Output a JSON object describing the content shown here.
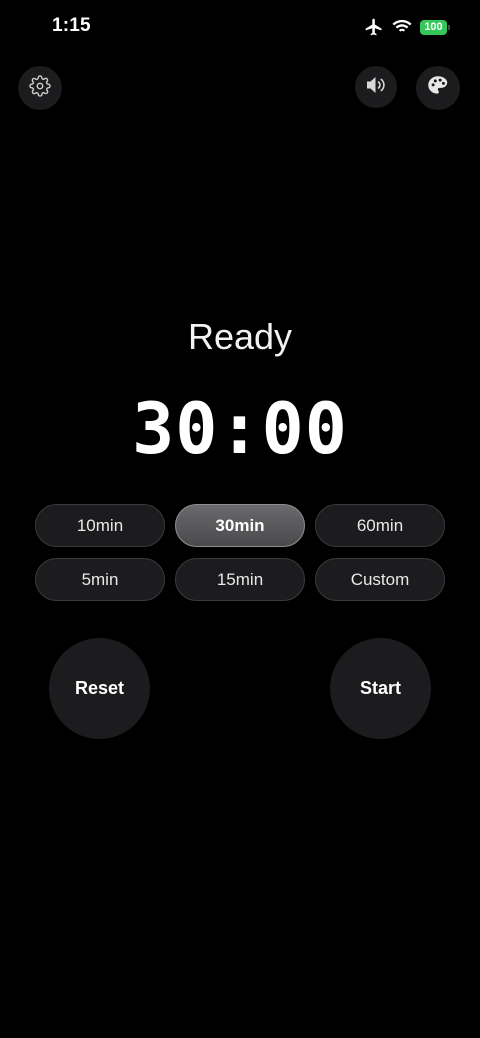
{
  "status_bar": {
    "time": "1:15",
    "battery_level": "100",
    "battery_color": "#34c759",
    "icons": [
      "airplane-icon",
      "wifi-icon",
      "battery-icon"
    ]
  },
  "toolbar": {
    "settings_icon": "gear-icon",
    "sound_icon": "speaker-icon",
    "theme_icon": "palette-icon"
  },
  "timer": {
    "state": "Ready",
    "display": "30:00"
  },
  "presets": [
    {
      "label": "10min",
      "selected": false
    },
    {
      "label": "30min",
      "selected": true
    },
    {
      "label": "60min",
      "selected": false
    },
    {
      "label": "5min",
      "selected": false
    },
    {
      "label": "15min",
      "selected": false
    },
    {
      "label": "Custom",
      "selected": false
    }
  ],
  "controls": {
    "reset_label": "Reset",
    "start_label": "Start"
  },
  "colors": {
    "background": "#000000",
    "button_bg": "#1c1c1e",
    "selected_bg": "#5a5a5c",
    "text": "#ffffff"
  }
}
